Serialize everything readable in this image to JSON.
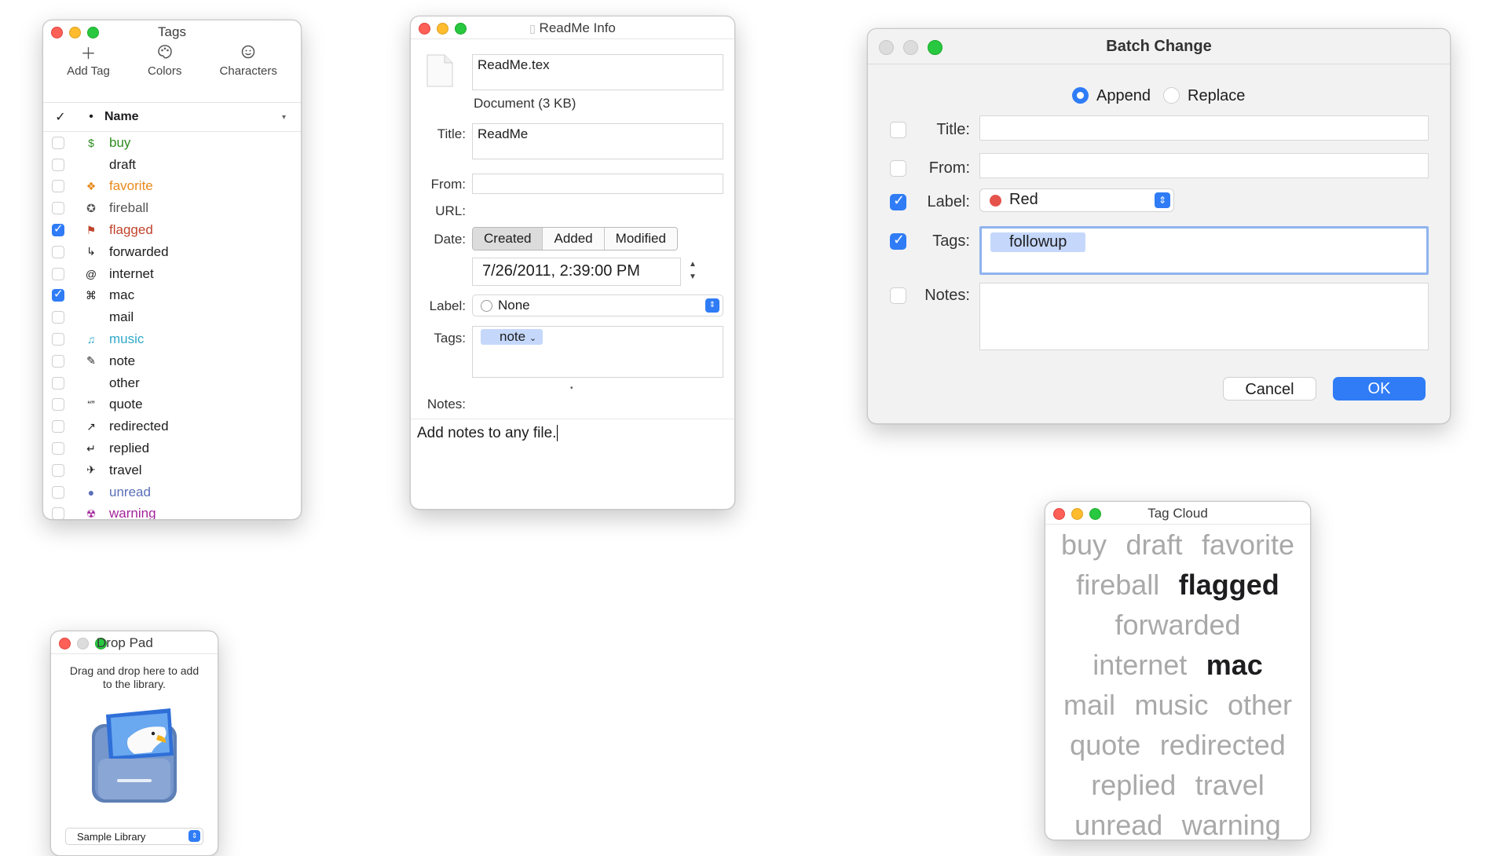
{
  "tags_window": {
    "title": "Tags",
    "toolbar": [
      {
        "label": "Add Tag",
        "icon": "plus-icon"
      },
      {
        "label": "Colors",
        "icon": "palette-icon"
      },
      {
        "label": "Characters",
        "icon": "smiley-icon"
      }
    ],
    "header": {
      "check": "✓",
      "dot": "•",
      "name": "Name",
      "sort": "▾"
    },
    "rows": [
      {
        "name": "buy",
        "glyph": "$",
        "color": "#2e8b1f",
        "checked": false
      },
      {
        "name": "draft",
        "glyph": "",
        "color": "#1d1d1f",
        "checked": false
      },
      {
        "name": "favorite",
        "glyph": "❖",
        "color": "#e8891a",
        "checked": false
      },
      {
        "name": "fireball",
        "glyph": "✪",
        "color": "#555555",
        "checked": false
      },
      {
        "name": "flagged",
        "glyph": "⚑",
        "color": "#c0442c",
        "checked": true
      },
      {
        "name": "forwarded",
        "glyph": "↳",
        "color": "#1d1d1f",
        "checked": false
      },
      {
        "name": "internet",
        "glyph": "@",
        "color": "#1d1d1f",
        "checked": false
      },
      {
        "name": "mac",
        "glyph": "⌘",
        "color": "#1d1d1f",
        "checked": true
      },
      {
        "name": "mail",
        "glyph": "",
        "color": "#1d1d1f",
        "checked": false
      },
      {
        "name": "music",
        "glyph": "♫",
        "color": "#2fa8c8",
        "checked": false
      },
      {
        "name": "note",
        "glyph": "✎",
        "color": "#1d1d1f",
        "checked": false
      },
      {
        "name": "other",
        "glyph": "",
        "color": "#1d1d1f",
        "checked": false
      },
      {
        "name": "quote",
        "glyph": "“”",
        "color": "#1d1d1f",
        "checked": false
      },
      {
        "name": "redirected",
        "glyph": "↗",
        "color": "#1d1d1f",
        "checked": false
      },
      {
        "name": "replied",
        "glyph": "↵",
        "color": "#1d1d1f",
        "checked": false
      },
      {
        "name": "travel",
        "glyph": "✈",
        "color": "#1d1d1f",
        "checked": false
      },
      {
        "name": "unread",
        "glyph": "●",
        "color": "#5a6fb8",
        "checked": false
      },
      {
        "name": "warning",
        "glyph": "☢",
        "color": "#a3259b",
        "checked": false
      }
    ]
  },
  "info_window": {
    "title": "ReadMe Info",
    "filename": "ReadMe.tex",
    "kind": "Document (3 KB)",
    "labels": {
      "title": "Title:",
      "from": "From:",
      "url": "URL:",
      "date": "Date:",
      "label": "Label:",
      "tags": "Tags:",
      "notes": "Notes:"
    },
    "title_value": "ReadMe",
    "from_value": "",
    "date_tabs": [
      "Created",
      "Added",
      "Modified"
    ],
    "date_selected": "Created",
    "date_value": "7/26/2011,   2:39:00 PM",
    "label_value": "None",
    "tag_token": "note",
    "notes_value": "Add notes to any file."
  },
  "batch_window": {
    "title": "Batch Change",
    "mode_options": [
      "Append",
      "Replace"
    ],
    "mode_selected": "Append",
    "labels": {
      "title": "Title:",
      "from": "From:",
      "label": "Label:",
      "tags": "Tags:",
      "notes": "Notes:"
    },
    "checked": {
      "title": false,
      "from": false,
      "label": true,
      "tags": true,
      "notes": false
    },
    "label_value": "Red",
    "label_color": "#e5534b",
    "tag_token": "followup",
    "cancel": "Cancel",
    "ok": "OK",
    "accent": "#2f7cf6"
  },
  "drop_window": {
    "title": "Drop Pad",
    "instruction": "Drag and drop here to add to the library.",
    "library": "Sample Library"
  },
  "cloud_window": {
    "title": "Tag Cloud",
    "tags": [
      {
        "name": "buy",
        "hot": false
      },
      {
        "name": "draft",
        "hot": false
      },
      {
        "name": "favorite",
        "hot": false
      },
      {
        "name": "fireball",
        "hot": false
      },
      {
        "name": "flagged",
        "hot": true
      },
      {
        "name": "forwarded",
        "hot": false
      },
      {
        "name": "internet",
        "hot": false
      },
      {
        "name": "mac",
        "hot": true
      },
      {
        "name": "mail",
        "hot": false
      },
      {
        "name": "music",
        "hot": false
      },
      {
        "name": "other",
        "hot": false
      },
      {
        "name": "quote",
        "hot": false
      },
      {
        "name": "redirected",
        "hot": false
      },
      {
        "name": "replied",
        "hot": false
      },
      {
        "name": "travel",
        "hot": false
      },
      {
        "name": "unread",
        "hot": false
      },
      {
        "name": "warning",
        "hot": false
      }
    ]
  }
}
